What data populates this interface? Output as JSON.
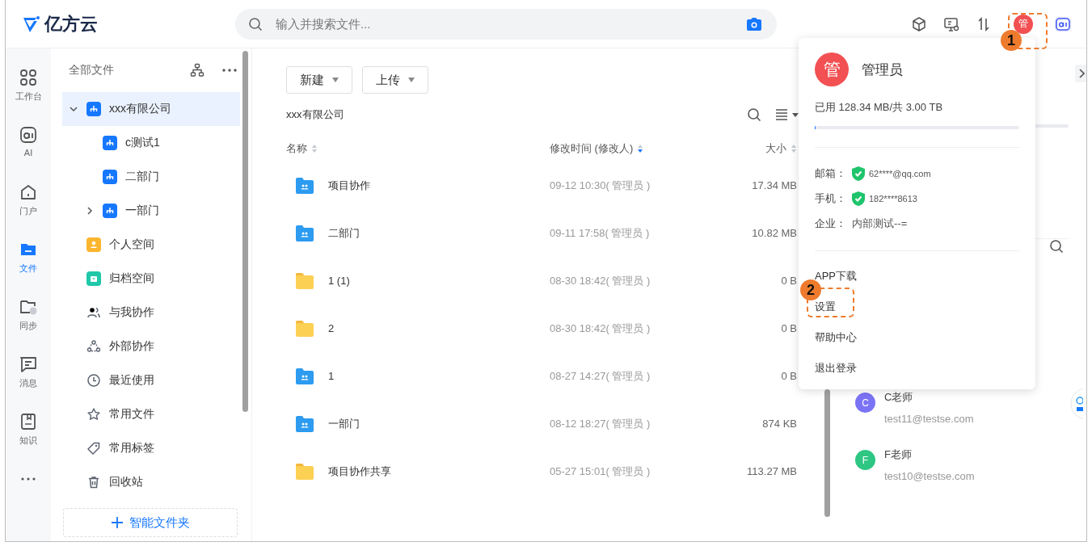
{
  "header": {
    "logo": "亿方云",
    "search": {
      "placeholder": "输入并搜索文件..."
    },
    "avatar": "管"
  },
  "rail": [
    {
      "kind": "grid",
      "label": "工作台",
      "selected": false
    },
    {
      "kind": "ai",
      "label": "AI",
      "selected": false
    },
    {
      "kind": "home",
      "label": "门户",
      "selected": false
    },
    {
      "kind": "folder",
      "label": "文件",
      "selected": true
    },
    {
      "kind": "sync",
      "label": "同步",
      "selected": false
    },
    {
      "kind": "message",
      "label": "消息",
      "selected": false
    },
    {
      "kind": "book",
      "label": "知识",
      "selected": false
    },
    {
      "kind": "more",
      "selected": false
    }
  ],
  "tree": {
    "title": "全部文件",
    "items": [
      {
        "label": "xxx有限公司",
        "kind": "org",
        "selected": true,
        "expanded": true,
        "children": [
          {
            "label": "c测试1",
            "kind": "org",
            "selected": false
          },
          {
            "label": "二部门",
            "kind": "org",
            "selected": false
          },
          {
            "label": "一部门",
            "kind": "org",
            "selected": false,
            "expanded": false
          }
        ]
      },
      {
        "label": "个人空间",
        "kind": "personal",
        "selected": false
      },
      {
        "label": "归档空间",
        "kind": "archive",
        "selected": false
      },
      {
        "label": "与我协作",
        "kind": "collab",
        "selected": false
      },
      {
        "label": "外部协作",
        "kind": "external",
        "selected": false
      },
      {
        "label": "最近使用",
        "kind": "recent",
        "selected": false
      },
      {
        "label": "常用文件",
        "kind": "star",
        "selected": false
      },
      {
        "label": "常用标签",
        "kind": "tag",
        "selected": false
      },
      {
        "label": "回收站",
        "kind": "trash",
        "selected": false
      }
    ],
    "add_button": "智能文件夹"
  },
  "files": {
    "buttons": [
      "新建",
      "上传"
    ],
    "breadcrumb": "xxx有限公司",
    "columns": [
      {
        "label": "名称",
        "sorted": false
      },
      {
        "label": "修改时间 (修改人)",
        "sorted": true
      },
      {
        "label": "大小",
        "sorted": false
      }
    ],
    "rows": [
      {
        "name": "项目协作",
        "kind": "shared",
        "modified": "09-12 10:30( 管理员 )",
        "size": "17.34 MB"
      },
      {
        "name": "二部门",
        "kind": "shared",
        "modified": "09-11 17:58( 管理员 )",
        "size": "10.82 MB"
      },
      {
        "name": "1 (1)",
        "kind": "folder",
        "modified": "08-30 18:42( 管理员 )",
        "size": "0 B"
      },
      {
        "name": "2",
        "kind": "folder",
        "modified": "08-30 18:42( 管理员 )",
        "size": "0 B"
      },
      {
        "name": "1",
        "kind": "shared",
        "modified": "08-27 14:27( 管理员 )",
        "size": "0 B"
      },
      {
        "name": "一部门",
        "kind": "shared",
        "modified": "08-12 18:27( 管理员 )",
        "size": "874 KB"
      },
      {
        "name": "项目协作共享",
        "kind": "folder",
        "modified": "05-27 15:01( 管理员 )",
        "size": "113.27 MB"
      }
    ]
  },
  "contacts": [
    {
      "initial": "C",
      "name": "C老师",
      "email": "test11@testse.com",
      "color": "#7b73f5"
    },
    {
      "initial": "F",
      "name": "F老师",
      "email": "test10@testse.com",
      "color": "#2ec683"
    }
  ],
  "user_menu": {
    "avatar": "管",
    "name": "管理员",
    "usage": "已用 128.34 MB/共 3.00 TB",
    "level": 0.001,
    "info": [
      {
        "label": "邮箱：",
        "value": "62****@qq.com",
        "verified": true
      },
      {
        "label": "手机：",
        "value": "182****8613",
        "verified": true
      },
      {
        "label": "企业：",
        "value": "内部测试--=",
        "verified": false
      }
    ],
    "items": [
      "APP下载",
      "设置",
      "帮助中心",
      "退出登录"
    ]
  },
  "annotations": [
    "1",
    "2"
  ]
}
